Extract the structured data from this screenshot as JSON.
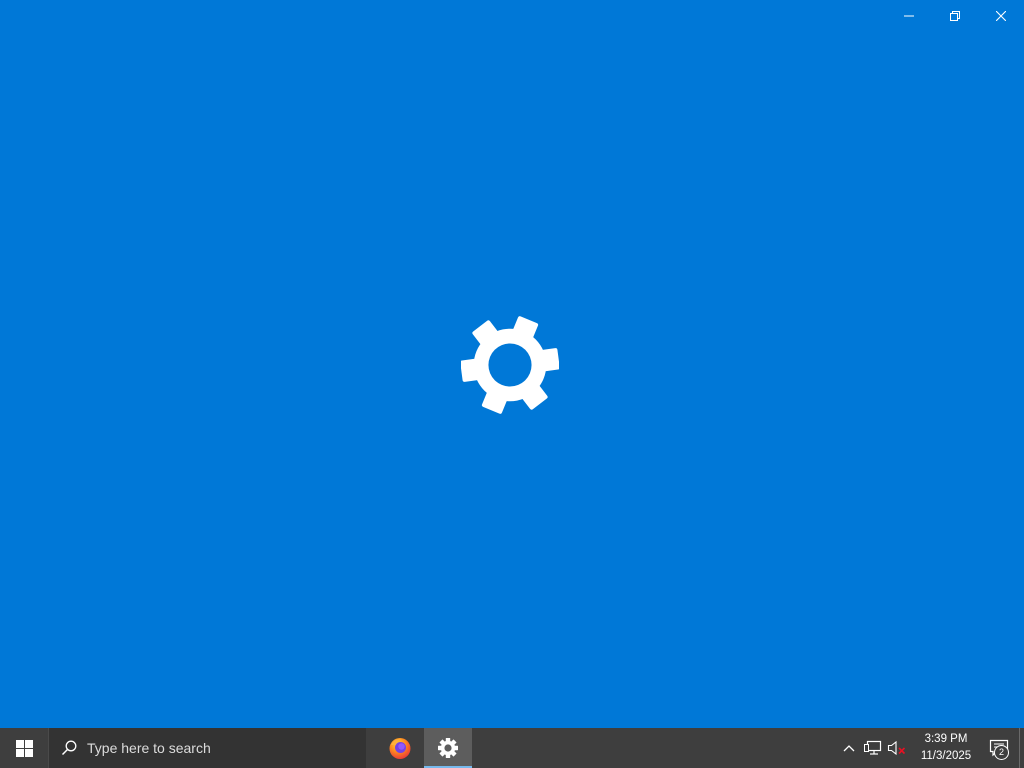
{
  "window": {
    "background_color": "#0078d7",
    "controls": {
      "minimize_icon": "minimize-icon",
      "restore_icon": "restore-icon",
      "close_icon": "close-icon"
    },
    "splash_icon": "settings-gear-icon"
  },
  "taskbar": {
    "background_color": "#3e3e3e",
    "start_icon": "windows-logo-icon",
    "search": {
      "icon": "search-icon",
      "placeholder": "Type here to search"
    },
    "pinned_apps": [
      {
        "name": "Firefox",
        "icon": "firefox-icon",
        "active": false
      },
      {
        "name": "Settings",
        "icon": "settings-gear-icon",
        "active": true
      }
    ],
    "tray": {
      "chevron_icon": "chevron-up-icon",
      "network_icon": "network-icon",
      "volume_icon": "volume-muted-icon",
      "time": "3:39 PM",
      "date": "11/3/2025",
      "notifications_icon": "action-center-icon",
      "notification_count": "2"
    }
  }
}
